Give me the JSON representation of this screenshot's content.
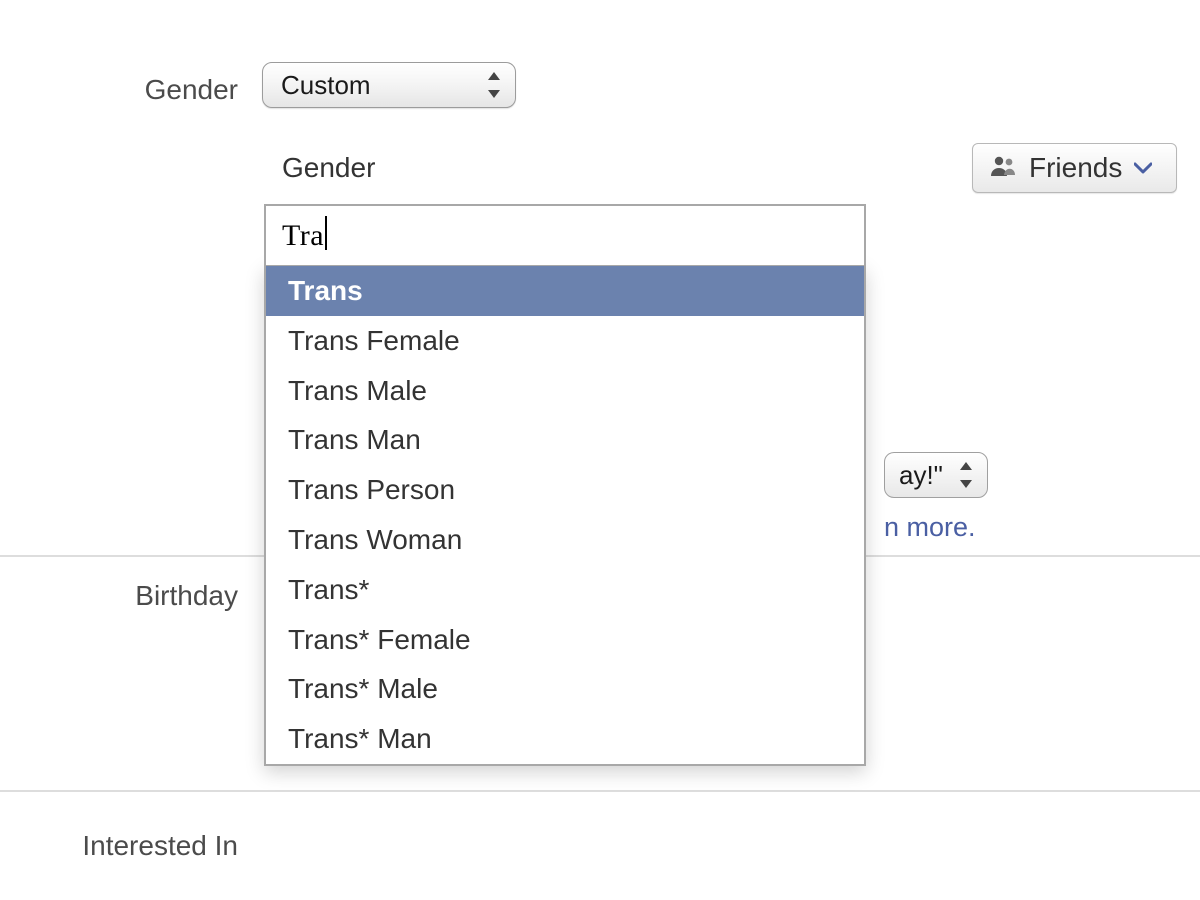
{
  "labels": {
    "gender": "Gender",
    "birthday": "Birthday",
    "interested_in": "Interested In"
  },
  "gender_select": {
    "selected": "Custom"
  },
  "custom_gender": {
    "sublabel": "Gender",
    "input_value": "Tra",
    "suggestions": [
      "Trans",
      "Trans Female",
      "Trans Male",
      "Trans Man",
      "Trans Person",
      "Trans Woman",
      "Trans*",
      "Trans* Female",
      "Trans* Male",
      "Trans* Man"
    ],
    "highlight_index": 0
  },
  "privacy": {
    "label": "Friends"
  },
  "hidden_select_fragment": "ay!\"",
  "learn_more_fragment": "n more."
}
